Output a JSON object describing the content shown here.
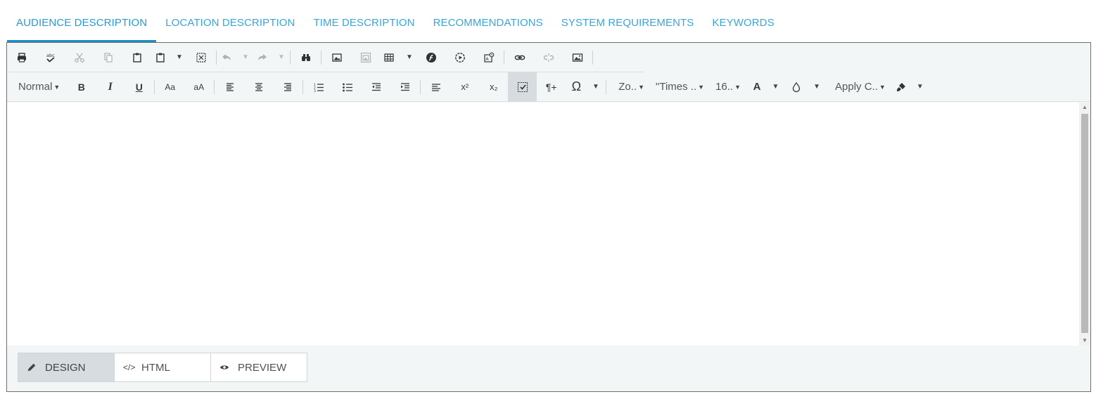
{
  "tabs": [
    {
      "label": "AUDIENCE DESCRIPTION",
      "active": true
    },
    {
      "label": "LOCATION DESCRIPTION"
    },
    {
      "label": "TIME DESCRIPTION"
    },
    {
      "label": "RECOMMENDATIONS"
    },
    {
      "label": "SYSTEM REQUIREMENTS"
    },
    {
      "label": "KEYWORDS"
    }
  ],
  "toolbar": {
    "row1_icons": [
      "print-icon",
      "spellcheck-icon",
      "cut-icon",
      "copy-icon",
      "paste-icon",
      "paste-options-icon",
      "fullscreen-icon",
      "undo-icon",
      "redo-icon",
      "find-replace-icon",
      "image-manager-icon",
      "image-properties-icon",
      "table-icon",
      "flash-icon",
      "media-icon",
      "template-icon",
      "link-icon",
      "unlink-icon",
      "image-icon"
    ],
    "paragraph_style": "Normal",
    "bold_glyph": "B",
    "italic_glyph": "I",
    "underline_glyph": "U",
    "case_lower_glyph": "Aa",
    "case_upper_glyph": "aA",
    "superscript_glyph": "x²",
    "subscript_glyph": "x₂",
    "paragraph_glyph": "¶+",
    "symbol_glyph": "Ω",
    "zoom": "Zo..",
    "font_name": "\"Times ..",
    "font_size": "16..",
    "forecolor_glyph": "A",
    "apply_css": "Apply C.."
  },
  "modes": [
    {
      "label": "DESIGN",
      "icon": "pencil-icon",
      "active": true
    },
    {
      "label": "HTML",
      "icon": "code-icon"
    },
    {
      "label": "PREVIEW",
      "icon": "eye-icon"
    }
  ],
  "colors": {
    "accent": "#3aa6d6",
    "active_tab_underline": "#1d8fc7",
    "toolbar_bg": "#f3f6f6",
    "active_button": "#d6dcdf"
  }
}
